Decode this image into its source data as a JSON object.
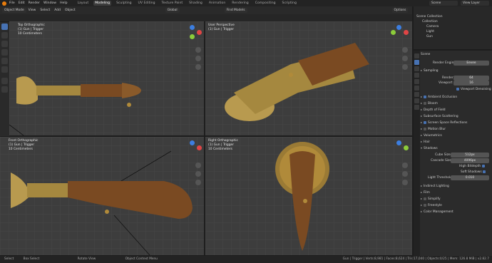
{
  "topbar": {
    "menus": [
      "File",
      "Edit",
      "Render",
      "Window",
      "Help"
    ],
    "workspaces": [
      "Layout",
      "Modeling",
      "Sculpting",
      "UV Editing",
      "Texture Paint",
      "Shading",
      "Animation",
      "Rendering",
      "Compositing",
      "Scripting"
    ],
    "active_workspace": "Modeling",
    "scene": "Scene",
    "view_layer": "View Layer"
  },
  "viewport_header": {
    "mode": "Object Mode",
    "menus": [
      "View",
      "Select",
      "Add",
      "Object"
    ],
    "orientation": "Global",
    "find_models": "Find Models",
    "options": "Options"
  },
  "viewports": {
    "top": {
      "title": "Top Orthographic",
      "obj": "(1) Gun | Trigger",
      "scale": "10 Centimeters"
    },
    "user": {
      "title": "User Perspective",
      "obj": "(1) Gun | Trigger"
    },
    "front": {
      "title": "Front Orthographic",
      "obj": "(1) Gun | Trigger",
      "scale": "10 Centimeters"
    },
    "right": {
      "title": "Right Orthographic",
      "obj": "(1) Gun | Trigger",
      "scale": "10 Centimeters"
    }
  },
  "outliner": {
    "title": "Scene Collection",
    "rows": [
      "Collection",
      "Camera",
      "Light",
      "Gun"
    ]
  },
  "properties": {
    "scene_label": "Scene",
    "render_engine_label": "Render Engine",
    "render_engine_value": "Eevee",
    "sampling": "Sampling",
    "render_label": "Render",
    "render_value": "64",
    "viewport_label": "Viewport",
    "viewport_value": "16",
    "viewport_denoising": "Viewport Denoising",
    "panels": [
      "Ambient Occlusion",
      "Bloom",
      "Depth of Field",
      "Subsurface Scattering",
      "Screen Space Reflections",
      "Motion Blur",
      "Volumetrics",
      "Hair",
      "Shadows"
    ],
    "cube_size_label": "Cube Size",
    "cube_size_value": "512px",
    "cascade_size_label": "Cascade Size",
    "cascade_size_value": "4096px",
    "high_bitdepth": "High Bitdepth",
    "soft_shadows": "Soft Shadows",
    "light_threshold_label": "Light Threshold",
    "light_threshold_value": "0.010",
    "panels2": [
      "Indirect Lighting",
      "Film",
      "Simplify",
      "Freestyle",
      "Color Management"
    ]
  },
  "statusbar": {
    "select": "Select",
    "box_select": "Box Select",
    "rotate_view": "Rotate View",
    "context_menu": "Object Context Menu",
    "stats": "Gun | Trigger | Verts:8,981 | Faces:8,624 | Tris:17,040 | Objects:0/25 | Mem: 126.8 MiB | v2.82.7"
  },
  "colors": {
    "accent": "#4772b3",
    "brass": "#b08a3a",
    "wood": "#7a4a22",
    "x_axis": "#e04545",
    "y_axis": "#8ccc3a",
    "z_axis": "#3c7ee0"
  }
}
